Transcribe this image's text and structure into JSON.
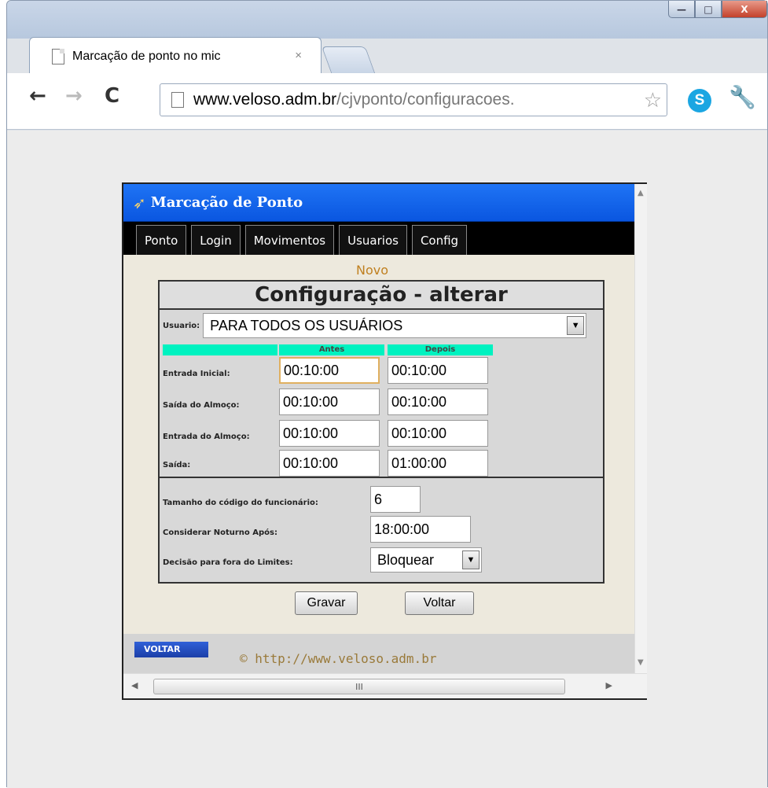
{
  "browser": {
    "tab_title": "Marcação de ponto no mic",
    "tab_close": "×",
    "url_host": "www.veloso.adm.br",
    "url_path": "/cjvponto/configuracoes.",
    "buttons": {
      "back": "←",
      "forward": "→",
      "reload": "C",
      "minimize": "—",
      "maximize": "□",
      "close": "X"
    }
  },
  "app": {
    "title": "Marcação de Ponto",
    "menu": [
      "Ponto",
      "Login",
      "Movimentos",
      "Usuarios",
      "Config"
    ]
  },
  "form": {
    "novo": "Novo",
    "title": "Configuração - alterar",
    "usuario_label": "Usuario:",
    "usuario_value": "PARA TODOS OS USUÁRIOS",
    "col_antes": "Antes",
    "col_depois": "Depois",
    "rows": [
      {
        "label": "Entrada Inicial:",
        "antes": "00:10:00",
        "depois": "00:10:00"
      },
      {
        "label": "Saída do Almoço:",
        "antes": "00:10:00",
        "depois": "00:10:00"
      },
      {
        "label": "Entrada do Almoço:",
        "antes": "00:10:00",
        "depois": "00:10:00"
      },
      {
        "label": "Saída:",
        "antes": "00:10:00",
        "depois": "01:00:00"
      }
    ],
    "tamanho_label": "Tamanho do código do funcionário:",
    "tamanho_value": "6",
    "noturno_label": "Considerar Noturno Após:",
    "noturno_value": "18:00:00",
    "decisao_label": "Decisão para fora do Limites:",
    "decisao_value": "Bloquear",
    "gravar": "Gravar",
    "voltar": "Voltar"
  },
  "footer": {
    "voltar_badge": "VOLTAR",
    "copyright": "© http://www.veloso.adm.br"
  },
  "scrollbar": {
    "grip": "III"
  }
}
